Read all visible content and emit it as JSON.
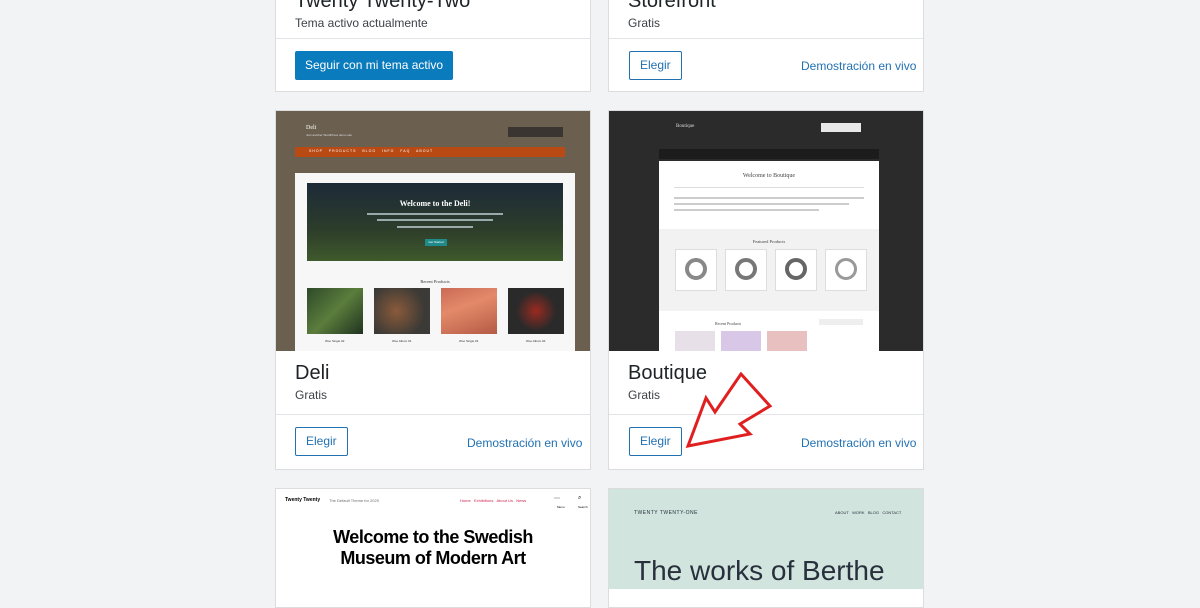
{
  "themes": [
    {
      "name": "Twenty Twenty-Two",
      "status": "Tema activo actualmente",
      "action": "Seguir con mi tema activo"
    },
    {
      "name": "Storefront",
      "status": "Gratis",
      "action": "Elegir",
      "demo": "Demostración en vivo"
    },
    {
      "name": "Deli",
      "status": "Gratis",
      "action": "Elegir",
      "demo": "Demostración en vivo",
      "preview": {
        "site_title": "Deli",
        "tagline": "Just another WordPress demo site",
        "nav": [
          "SHOP",
          "PRODUCTS",
          "BLOG",
          "INFO",
          "FAQ",
          "ABOUT"
        ],
        "hero_title": "Welcome to the Deli!",
        "hero_button": "Get Started",
        "section": "Recent Products",
        "products": [
          "Woo Single #2",
          "Woo Album #1",
          "Woo Single #1",
          "Woo Album #4"
        ]
      }
    },
    {
      "name": "Boutique",
      "status": "Gratis",
      "action": "Elegir",
      "demo": "Demostración en vivo",
      "preview": {
        "site_title": "Boutique",
        "welcome": "Welcome to Boutique",
        "featured": "Featured Products",
        "recent": "Recent Products"
      }
    },
    {
      "name": "Twenty Twenty",
      "preview": {
        "site_title": "Twenty Twenty",
        "tagline": "The Default Theme for 2020",
        "nav": [
          "Home",
          "Exhibitions",
          "About Us",
          "News"
        ],
        "menu_label": "Menu",
        "search_label": "Search",
        "heading_line1": "Welcome to the Swedish",
        "heading_line2": "Museum of Modern Art"
      }
    },
    {
      "name": "Twenty Twenty-One",
      "preview": {
        "site_title": "TWENTY TWENTY-ONE",
        "nav": [
          "ABOUT",
          "WORK",
          "BLOG",
          "CONTACT"
        ],
        "heading": "The works of Berthe"
      }
    }
  ],
  "colors": {
    "accent": "#2271b1",
    "primary_button": "#0a7bbd",
    "annotation_arrow": "#e02020"
  }
}
